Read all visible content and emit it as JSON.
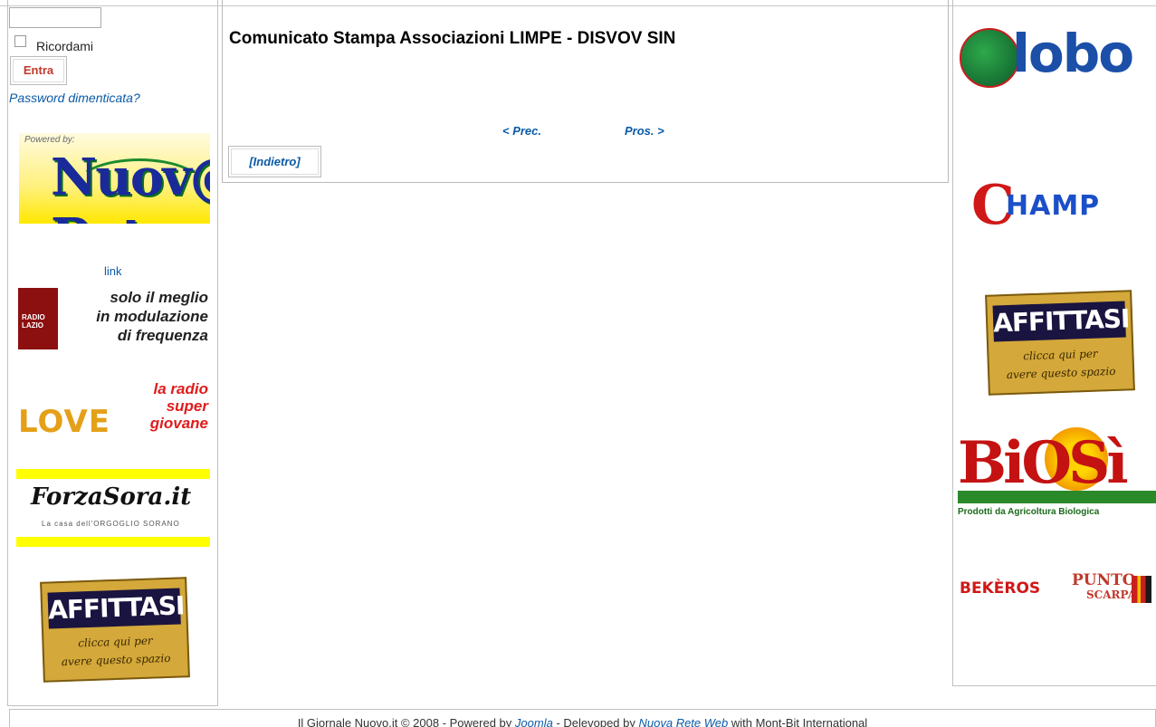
{
  "login": {
    "username_value": "",
    "remember_label": "Ricordami",
    "login_button": "Entra",
    "forgot_link": "Password dimenticata?"
  },
  "article": {
    "title": "Comunicato Stampa Associazioni LIMPE - DISVOV SIN",
    "prev_link": "< Prec.",
    "next_link": "Pros. >",
    "back_button": "[Indietro]"
  },
  "left_banners": {
    "nuova_powered": "Powered by:",
    "nuova_logo": "Nuov@ Rete",
    "link_text": "link",
    "radio_lazio_box": "RADIO LAZIO",
    "radio_lazio_line1": "solo il meglio",
    "radio_lazio_line2": "in modulazione",
    "radio_lazio_line3": "di frequenza",
    "love_word": "LOVE",
    "love_line1": "la radio",
    "love_line2": "super",
    "love_line3": "giovane",
    "forza_logo": "ForzaSora.it",
    "forza_sub": "La casa dell'ORGOGLIO SORANO",
    "affittasi_big": "AFFITTASI",
    "affittasi_s1": "clicca qui per",
    "affittasi_s2": "avere questo spazio"
  },
  "right_banners": {
    "globo": "lobo",
    "champ_c": "C",
    "champ": "HAMP",
    "affittasi_big": "AFFITTASI",
    "affittasi_s1": "clicca qui per",
    "affittasi_s2": "avere questo spazio",
    "biosi": "BiOSì",
    "biosi_sub": "Prodotti da Agricoltura Biologica",
    "bekeros": "BEKÈROS",
    "punto": "PUNTO",
    "scarpa": "SCARPA"
  },
  "footer": {
    "prefix": "Il Giornale Nuovo.it © 2008 - Powered by ",
    "joomla": "Joomla",
    "mid": " - Delevoped by ",
    "nuova_rete": "Nuova Rete Web",
    "suffix": " with Mont-Bit International"
  }
}
